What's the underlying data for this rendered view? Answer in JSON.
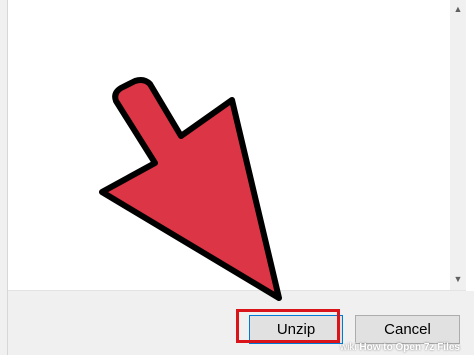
{
  "dialog": {
    "buttons": {
      "unzip_label": "Unzip",
      "cancel_label": "Cancel"
    },
    "scrollbar": {
      "up_glyph": "▲",
      "down_glyph": "▼"
    }
  },
  "annotation": {
    "arrow_color": "#dc3545",
    "arrow_outline": "#000000",
    "highlight_color": "#d9141b"
  },
  "watermark": {
    "wiki": "wiki",
    "title": "How to Open 7z Files"
  }
}
